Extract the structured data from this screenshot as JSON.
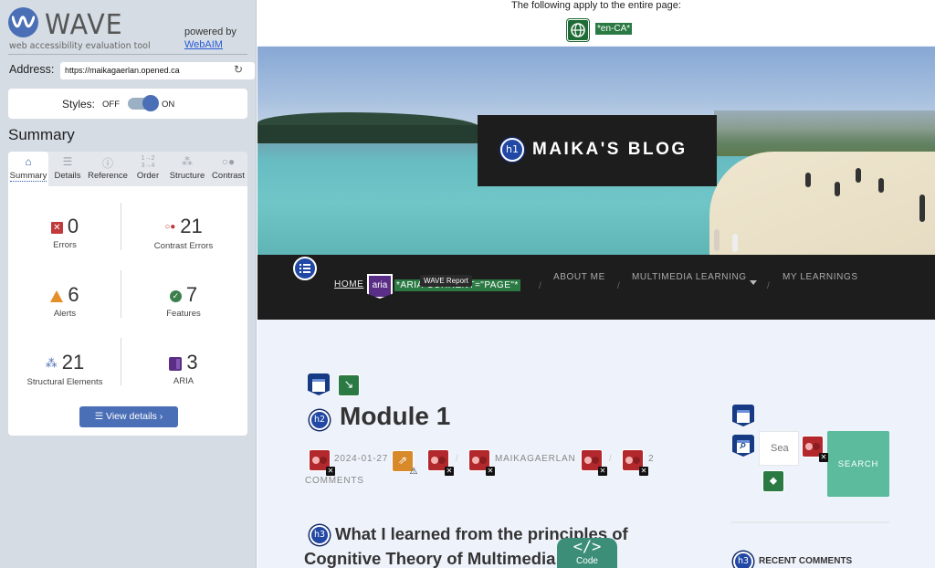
{
  "sidebar": {
    "logo": {
      "wordmark": "WAVE",
      "tagline": "web accessibility evaluation tool",
      "powered_by": "powered by",
      "powered_link": "WebAIM"
    },
    "address": {
      "label": "Address:",
      "value": "https://maikagaerlan.opened.ca",
      "reload_icon": "reload-icon"
    },
    "styles": {
      "label": "Styles:",
      "off": "OFF",
      "on": "ON",
      "state": "on"
    },
    "summary_title": "Summary",
    "tabs": [
      {
        "label": "Summary",
        "icon": "home-icon",
        "active": true
      },
      {
        "label": "Details",
        "icon": "list-icon"
      },
      {
        "label": "Reference",
        "icon": "info-icon"
      },
      {
        "label": "Order",
        "icon": "order-icon"
      },
      {
        "label": "Structure",
        "icon": "structure-icon"
      },
      {
        "label": "Contrast",
        "icon": "contrast-icon"
      }
    ],
    "stats": {
      "errors": {
        "count": "0",
        "label": "Errors"
      },
      "contrast_errors": {
        "count": "21",
        "label": "Contrast Errors"
      },
      "alerts": {
        "count": "6",
        "label": "Alerts"
      },
      "features": {
        "count": "7",
        "label": "Features"
      },
      "structural": {
        "count": "21",
        "label": "Structural Elements"
      },
      "aria": {
        "count": "3",
        "label": "ARIA"
      }
    },
    "view_details": "View details ›"
  },
  "page": {
    "banner_text": "The following apply to the entire page:",
    "lang_tag": "*en-CA*",
    "site_title": "MAIKA'S BLOG",
    "h1_badge": "h1",
    "nav": {
      "home": "HOME",
      "aria_badge": "aria",
      "aria_tag": "*ARIA-CURRENT=\"PAGE\"*",
      "tooltip": "WAVE Report",
      "items": [
        "ABOUT ME",
        "MULTIMEDIA LEARNING",
        "MY LEARNINGS"
      ],
      "separator": "/"
    },
    "post": {
      "h2_badge": "h2",
      "title": "Module 1",
      "date": "2024-01-27",
      "author": "MAIKAGAERLAN",
      "comments_count": "2",
      "comments_label": "COMMENTS",
      "h3_badge": "h3",
      "subtitle_line1": "What I learned from the principles of",
      "subtitle_line2": "Cognitive Theory of Multimedia L"
    },
    "search": {
      "placeholder": "Sea",
      "button": "SEARCH"
    },
    "recent_comments": "RECENT COMMENTS",
    "code_tab": {
      "brackets": "</>",
      "label": "Code"
    }
  },
  "colors": {
    "wave_blue": "#4b6fb6",
    "error_red": "#c0393b",
    "alert_orange": "#e48f2a",
    "feature_green": "#3d7f4c",
    "aria_purple": "#5a2e86",
    "search_teal": "#5bbb9c"
  }
}
